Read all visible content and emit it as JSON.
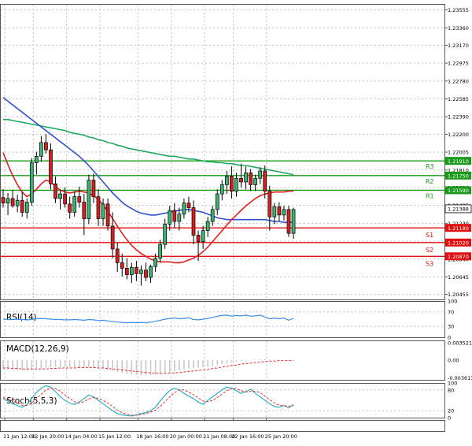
{
  "colors": {
    "background": "#ffffff",
    "frame": "#555555",
    "grid": "#c0c0c0",
    "candle": "#000000",
    "bull_fill": "#3cb371",
    "bear_fill": "#d42020",
    "ma_fast": "#e02020",
    "ma_mid": "#3050d0",
    "ma_slow": "#20a860",
    "resistance": "#1a9a1a",
    "support": "#e01010",
    "rsi": "#3a8ee6",
    "macd": "#c8c8c8",
    "macd_signal": "#e03030",
    "stoch_main": "#30b0c0",
    "stoch_signal": "#e03030",
    "current_price_bg": "#ffffff"
  },
  "chart_data": [
    {
      "type": "candlestick",
      "panel": "price",
      "ylim": [
        1.204,
        1.2362
      ],
      "y_ticks": [
        "1.23555",
        "1.23360",
        "1.23170",
        "1.22975",
        "1.22780",
        "1.22585",
        "1.22390",
        "1.22200",
        "1.22005",
        "1.21810",
        "1.21620",
        "1.21425",
        "1.21230",
        "1.21035",
        "1.20840",
        "1.20645",
        "1.20455"
      ],
      "candles": [
        {
          "o": 1.2151,
          "h": 1.216,
          "l": 1.214,
          "c": 1.2145
        },
        {
          "o": 1.2145,
          "h": 1.2156,
          "l": 1.2132,
          "c": 1.215
        },
        {
          "o": 1.215,
          "h": 1.2159,
          "l": 1.214,
          "c": 1.2142
        },
        {
          "o": 1.2142,
          "h": 1.2154,
          "l": 1.2135,
          "c": 1.2148
        },
        {
          "o": 1.2148,
          "h": 1.2157,
          "l": 1.213,
          "c": 1.2135
        },
        {
          "o": 1.2135,
          "h": 1.215,
          "l": 1.2128,
          "c": 1.2146
        },
        {
          "o": 1.2146,
          "h": 1.2194,
          "l": 1.2142,
          "c": 1.2189
        },
        {
          "o": 1.2189,
          "h": 1.2201,
          "l": 1.2176,
          "c": 1.2196
        },
        {
          "o": 1.2196,
          "h": 1.2218,
          "l": 1.219,
          "c": 1.2211
        },
        {
          "o": 1.2211,
          "h": 1.222,
          "l": 1.2199,
          "c": 1.2203
        },
        {
          "o": 1.2203,
          "h": 1.221,
          "l": 1.216,
          "c": 1.2166
        },
        {
          "o": 1.2166,
          "h": 1.2174,
          "l": 1.2145,
          "c": 1.215
        },
        {
          "o": 1.215,
          "h": 1.216,
          "l": 1.2138,
          "c": 1.2155
        },
        {
          "o": 1.2155,
          "h": 1.2162,
          "l": 1.214,
          "c": 1.2144
        },
        {
          "o": 1.2144,
          "h": 1.2152,
          "l": 1.2128,
          "c": 1.2135
        },
        {
          "o": 1.2135,
          "h": 1.2158,
          "l": 1.213,
          "c": 1.2152
        },
        {
          "o": 1.2152,
          "h": 1.2163,
          "l": 1.214,
          "c": 1.2146
        },
        {
          "o": 1.2146,
          "h": 1.2155,
          "l": 1.211,
          "c": 1.2128
        },
        {
          "o": 1.2128,
          "h": 1.2176,
          "l": 1.2122,
          "c": 1.217
        },
        {
          "o": 1.217,
          "h": 1.2177,
          "l": 1.2145,
          "c": 1.2152
        },
        {
          "o": 1.2152,
          "h": 1.216,
          "l": 1.212,
          "c": 1.2128
        },
        {
          "o": 1.2128,
          "h": 1.215,
          "l": 1.212,
          "c": 1.2144
        },
        {
          "o": 1.2144,
          "h": 1.215,
          "l": 1.2115,
          "c": 1.212
        },
        {
          "o": 1.212,
          "h": 1.2135,
          "l": 1.2085,
          "c": 1.2095
        },
        {
          "o": 1.2095,
          "h": 1.2102,
          "l": 1.207,
          "c": 1.208
        },
        {
          "o": 1.208,
          "h": 1.209,
          "l": 1.2065,
          "c": 1.2074
        },
        {
          "o": 1.2074,
          "h": 1.2085,
          "l": 1.2062,
          "c": 1.2067
        },
        {
          "o": 1.2067,
          "h": 1.208,
          "l": 1.2058,
          "c": 1.2075
        },
        {
          "o": 1.2075,
          "h": 1.2082,
          "l": 1.206,
          "c": 1.2068
        },
        {
          "o": 1.2068,
          "h": 1.2077,
          "l": 1.2055,
          "c": 1.2072
        },
        {
          "o": 1.2072,
          "h": 1.208,
          "l": 1.206,
          "c": 1.2064
        },
        {
          "o": 1.2064,
          "h": 1.2078,
          "l": 1.2058,
          "c": 1.2076
        },
        {
          "o": 1.2076,
          "h": 1.209,
          "l": 1.207,
          "c": 1.2085
        },
        {
          "o": 1.2085,
          "h": 1.2105,
          "l": 1.208,
          "c": 1.21
        },
        {
          "o": 1.21,
          "h": 1.2128,
          "l": 1.2095,
          "c": 1.2122
        },
        {
          "o": 1.2122,
          "h": 1.2142,
          "l": 1.2115,
          "c": 1.2137
        },
        {
          "o": 1.2137,
          "h": 1.2145,
          "l": 1.2118,
          "c": 1.2125
        },
        {
          "o": 1.2125,
          "h": 1.214,
          "l": 1.2115,
          "c": 1.2133
        },
        {
          "o": 1.2133,
          "h": 1.215,
          "l": 1.2128,
          "c": 1.2145
        },
        {
          "o": 1.2145,
          "h": 1.2152,
          "l": 1.2135,
          "c": 1.214
        },
        {
          "o": 1.214,
          "h": 1.2148,
          "l": 1.21,
          "c": 1.211
        },
        {
          "o": 1.211,
          "h": 1.2115,
          "l": 1.2082,
          "c": 1.2103
        },
        {
          "o": 1.2103,
          "h": 1.212,
          "l": 1.2095,
          "c": 1.2115
        },
        {
          "o": 1.2115,
          "h": 1.213,
          "l": 1.2108,
          "c": 1.2125
        },
        {
          "o": 1.2125,
          "h": 1.2142,
          "l": 1.212,
          "c": 1.2138
        },
        {
          "o": 1.2138,
          "h": 1.216,
          "l": 1.2132,
          "c": 1.2155
        },
        {
          "o": 1.2155,
          "h": 1.217,
          "l": 1.2148,
          "c": 1.2165
        },
        {
          "o": 1.2165,
          "h": 1.218,
          "l": 1.2155,
          "c": 1.2174
        },
        {
          "o": 1.2174,
          "h": 1.2185,
          "l": 1.215,
          "c": 1.2158
        },
        {
          "o": 1.2158,
          "h": 1.2178,
          "l": 1.2152,
          "c": 1.2172
        },
        {
          "o": 1.2172,
          "h": 1.2188,
          "l": 1.2162,
          "c": 1.2168
        },
        {
          "o": 1.2168,
          "h": 1.2185,
          "l": 1.216,
          "c": 1.2178
        },
        {
          "o": 1.2178,
          "h": 1.2182,
          "l": 1.2158,
          "c": 1.2165
        },
        {
          "o": 1.2165,
          "h": 1.2176,
          "l": 1.2158,
          "c": 1.2172
        },
        {
          "o": 1.2172,
          "h": 1.2184,
          "l": 1.2166,
          "c": 1.218
        },
        {
          "o": 1.218,
          "h": 1.2186,
          "l": 1.215,
          "c": 1.2158
        },
        {
          "o": 1.2158,
          "h": 1.2164,
          "l": 1.2115,
          "c": 1.213
        },
        {
          "o": 1.213,
          "h": 1.2145,
          "l": 1.2122,
          "c": 1.2141
        },
        {
          "o": 1.2141,
          "h": 1.2146,
          "l": 1.2125,
          "c": 1.2132
        },
        {
          "o": 1.2132,
          "h": 1.2142,
          "l": 1.2126,
          "c": 1.2138
        },
        {
          "o": 1.2138,
          "h": 1.2142,
          "l": 1.2108,
          "c": 1.2112
        },
        {
          "o": 1.2112,
          "h": 1.214,
          "l": 1.2106,
          "c": 1.2138
        }
      ],
      "moving_averages": {
        "fast": [
          1.22,
          1.2187,
          1.2175,
          1.2165,
          1.2157,
          1.2152,
          1.2155,
          1.216,
          1.2166,
          1.217,
          1.2168,
          1.2163,
          1.2159,
          1.2157,
          1.2156,
          1.2157,
          1.2158,
          1.2157,
          1.2156,
          1.2153,
          1.2149,
          1.2143,
          1.2136,
          1.2128,
          1.212,
          1.2112,
          1.2105,
          1.2099,
          1.2094,
          1.209,
          1.2087,
          1.2084,
          1.2082,
          1.2081,
          1.2081,
          1.2081,
          1.208,
          1.208,
          1.2081,
          1.2083,
          1.2085,
          1.2088,
          1.2092,
          1.2097,
          1.2103,
          1.2109,
          1.2115,
          1.2121,
          1.2127,
          1.2132,
          1.2137,
          1.2142,
          1.2146,
          1.215,
          1.2153,
          1.2155,
          1.2156,
          1.2157,
          1.2157,
          1.2157,
          1.2158,
          1.2158
        ],
        "mid": [
          1.226,
          1.2256,
          1.2252,
          1.2248,
          1.2244,
          1.224,
          1.2236,
          1.2232,
          1.2228,
          1.2224,
          1.222,
          1.2216,
          1.2212,
          1.2208,
          1.2204,
          1.22,
          1.2196,
          1.2191,
          1.2186,
          1.218,
          1.2174,
          1.2168,
          1.2162,
          1.2156,
          1.2151,
          1.2146,
          1.2142,
          1.2139,
          1.2136,
          1.2134,
          1.2133,
          1.2132,
          1.2132,
          1.2133,
          1.2134,
          1.2135,
          1.2136,
          1.2137,
          1.2138,
          1.2138,
          1.2137,
          1.2136,
          1.2135,
          1.2133,
          1.2131,
          1.2129,
          1.2128,
          1.2127,
          1.2127,
          1.2127,
          1.2127,
          1.2127,
          1.2127,
          1.2127,
          1.2127,
          1.2127,
          1.2126,
          1.2125,
          1.2125,
          1.2124,
          1.2124,
          1.2124
        ],
        "slow": [
          1.2236,
          1.2236,
          1.2235,
          1.2234,
          1.2233,
          1.2232,
          1.2231,
          1.223,
          1.2229,
          1.2228,
          1.2227,
          1.2226,
          1.2225,
          1.2224,
          1.2222,
          1.2221,
          1.222,
          1.2219,
          1.2217,
          1.2216,
          1.2214,
          1.2213,
          1.2211,
          1.221,
          1.2208,
          1.2207,
          1.2205,
          1.2204,
          1.2203,
          1.2202,
          1.2201,
          1.22,
          1.2199,
          1.2198,
          1.2197,
          1.2196,
          1.2196,
          1.2195,
          1.2194,
          1.2193,
          1.2193,
          1.2192,
          1.2191,
          1.219,
          1.219,
          1.2189,
          1.2189,
          1.2188,
          1.2188,
          1.2187,
          1.2186,
          1.2186,
          1.2185,
          1.2184,
          1.2183,
          1.2182,
          1.2181,
          1.218,
          1.2179,
          1.2178,
          1.2177,
          1.2176
        ]
      },
      "levels": [
        {
          "label": "R3",
          "value": 1.2191,
          "price": "1.21910",
          "kind": "resistance"
        },
        {
          "label": "R2",
          "value": 1.2175,
          "price": "1.21750",
          "kind": "resistance"
        },
        {
          "label": "R1",
          "value": 1.2159,
          "price": "1.21590",
          "kind": "resistance"
        },
        {
          "label": "S1",
          "value": 1.2118,
          "price": "1.21180",
          "kind": "support"
        },
        {
          "label": "S2",
          "value": 1.2102,
          "price": "1.21020",
          "kind": "support"
        },
        {
          "label": "S3",
          "value": 1.2087,
          "price": "1.20870",
          "kind": "support"
        }
      ],
      "current_price": {
        "value": 1.21388,
        "price": "1.21388"
      }
    },
    {
      "type": "line",
      "panel": "rsi",
      "title": "RSI(14)",
      "ylim": [
        0,
        100
      ],
      "y_ticks": [
        "100",
        "70",
        "30",
        "0"
      ],
      "levels": [
        70,
        30
      ],
      "values": [
        50,
        49,
        49,
        50,
        49,
        48,
        49,
        51,
        52,
        51,
        50,
        49,
        49,
        48,
        48,
        49,
        48,
        47,
        49,
        48,
        46,
        47,
        45,
        43,
        42,
        41,
        40,
        41,
        40,
        41,
        40,
        42,
        44,
        47,
        50,
        52,
        53,
        51,
        52,
        54,
        49,
        48,
        50,
        52,
        55,
        58,
        60,
        61,
        58,
        60,
        59,
        61,
        58,
        59,
        61,
        56,
        51,
        53,
        51,
        53,
        47,
        52
      ]
    },
    {
      "type": "bar",
      "panel": "macd",
      "title": "MACD(12,26,9)",
      "ylim": [
        -0.004,
        0.004
      ],
      "y_ticks": [
        "0.003521",
        "0.00",
        "-0.003613"
      ],
      "values": [
        -0.0018,
        -0.0019,
        -0.0019,
        -0.002,
        -0.002,
        -0.002,
        -0.0019,
        -0.0018,
        -0.0017,
        -0.0016,
        -0.0015,
        -0.0014,
        -0.0014,
        -0.0014,
        -0.0014,
        -0.0014,
        -0.0014,
        -0.0015,
        -0.0015,
        -0.0016,
        -0.0017,
        -0.0018,
        -0.002,
        -0.0022,
        -0.0024,
        -0.0026,
        -0.0028,
        -0.0029,
        -0.003,
        -0.0031,
        -0.0031,
        -0.0031,
        -0.003,
        -0.0029,
        -0.0027,
        -0.0025,
        -0.0023,
        -0.0021,
        -0.0019,
        -0.0017,
        -0.0016,
        -0.0015,
        -0.0014,
        -0.0013,
        -0.0012,
        -0.001,
        -0.0008,
        -0.0006,
        -0.0005,
        -0.0003,
        -0.0002,
        -0.0001,
        0.0,
        0.0001,
        0.0002,
        0.0002,
        0.0001,
        0.0001,
        0.0,
        0.0,
        -0.0001,
        -0.0001
      ],
      "signal": [
        -0.0016,
        -0.0016,
        -0.0017,
        -0.0017,
        -0.0018,
        -0.0018,
        -0.0018,
        -0.0018,
        -0.0018,
        -0.0018,
        -0.0017,
        -0.0017,
        -0.0016,
        -0.0016,
        -0.0016,
        -0.0016,
        -0.0015,
        -0.0015,
        -0.0015,
        -0.0015,
        -0.0016,
        -0.0016,
        -0.0017,
        -0.0018,
        -0.0019,
        -0.002,
        -0.0021,
        -0.0022,
        -0.0023,
        -0.0024,
        -0.0025,
        -0.0026,
        -0.0026,
        -0.0027,
        -0.0027,
        -0.0026,
        -0.0026,
        -0.0025,
        -0.0024,
        -0.0023,
        -0.0022,
        -0.0021,
        -0.002,
        -0.0019,
        -0.0017,
        -0.0016,
        -0.0014,
        -0.0013,
        -0.0011,
        -0.001,
        -0.0008,
        -0.0007,
        -0.0006,
        -0.0005,
        -0.0004,
        -0.0003,
        -0.0002,
        -0.0002,
        -0.0001,
        -0.0001,
        -0.0001,
        -0.0001
      ]
    },
    {
      "type": "line",
      "panel": "stochastic",
      "title": "Stoch(5,5,3)",
      "ylim": [
        0,
        100
      ],
      "y_ticks": [
        "100",
        "80",
        "20",
        "0"
      ],
      "main": [
        55,
        48,
        40,
        35,
        30,
        38,
        55,
        72,
        85,
        92,
        88,
        75,
        60,
        50,
        42,
        38,
        45,
        55,
        65,
        60,
        50,
        40,
        30,
        20,
        12,
        8,
        6,
        5,
        8,
        12,
        15,
        20,
        30,
        48,
        65,
        78,
        85,
        80,
        70,
        62,
        55,
        45,
        38,
        50,
        60,
        70,
        80,
        88,
        85,
        78,
        70,
        75,
        82,
        70,
        60,
        50,
        40,
        32,
        30,
        35,
        28,
        38
      ],
      "signal": [
        58,
        54,
        48,
        42,
        36,
        35,
        42,
        55,
        68,
        80,
        86,
        84,
        76,
        65,
        55,
        46,
        42,
        46,
        54,
        58,
        56,
        50,
        42,
        32,
        22,
        14,
        10,
        7,
        7,
        9,
        12,
        16,
        22,
        32,
        46,
        60,
        72,
        80,
        80,
        74,
        66,
        57,
        48,
        46,
        50,
        58,
        68,
        78,
        84,
        84,
        78,
        74,
        76,
        76,
        72,
        62,
        52,
        42,
        36,
        34,
        33,
        35
      ]
    }
  ],
  "time_axis": {
    "labels": [
      {
        "i": 0,
        "text": "11 Jan 12:00"
      },
      {
        "i": 6,
        "text": "12 Jan 20:00"
      },
      {
        "i": 13,
        "text": "14 Jan 04:00"
      },
      {
        "i": 20,
        "text": "15 Jan 12:00"
      },
      {
        "i": 28,
        "text": "18 Jan 16:00"
      },
      {
        "i": 35,
        "text": "20 Jan 00:00"
      },
      {
        "i": 42,
        "text": "21 Jan 08:00"
      },
      {
        "i": 48,
        "text": "22 Jan 16:00"
      },
      {
        "i": 55,
        "text": "25 Jan 20:00"
      }
    ]
  }
}
